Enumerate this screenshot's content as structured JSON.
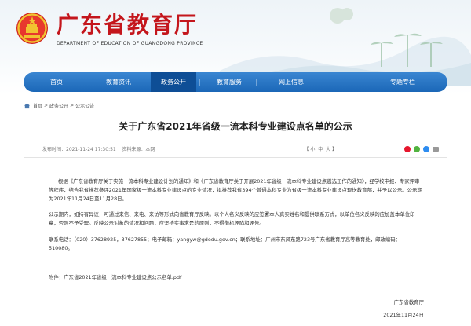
{
  "header": {
    "title": "广东省教育厅",
    "subtitle": "DEPARTMENT OF EDUCATION OF GUANGDONG PROVINCE"
  },
  "nav": {
    "items": [
      {
        "label": "首页"
      },
      {
        "label": "教育资讯"
      },
      {
        "label": "政务公开",
        "active": true
      },
      {
        "label": "教育服务"
      },
      {
        "label": "网上信息"
      },
      {
        "label": "专题专栏"
      }
    ]
  },
  "breadcrumb": {
    "home": "首页",
    "sep": ">",
    "level1": "政务公开",
    "level2": "公示公告"
  },
  "article": {
    "title": "关于广东省2021年省级一流本科专业建设点名单的公示",
    "date": "发布时间：2021-11-24 17:30:51",
    "source": "资料来源：本网",
    "font_label": "【",
    "font_small": "小",
    "font_mid": "中",
    "font_big": "大",
    "font_end": "】",
    "p1": "根据《广东省教育厅关于实施一流本科专业建设计划的通知》和《广东省教育厅关于开展2021年省级一流本科专业建设点遴选工作的通知》，经学校申报、专家评审等程序，结合我省推荐参评2021年国家级一流本科专业建设点的专业情况，拟推荐我省394个普通本科专业为省级一流本科专业建设点现送教育部，并予以公示。公示期为2021年11月24日至11月28日。",
    "p2": "公示期内，如持有异议，可通过来信、来电、来访等形式向省教育厅反映。以个人名义反映的应签署本人真实姓名和提供联系方式，以单位名义反映的应加盖本单位印章，否则不予受理。反映公示对象的情况和问题，应坚持实事求是的原则，不得借机诬陷和诬告。",
    "p3": "联系电话：（020）37628925，37627855；电子邮箱：yangyw@gdedu.gov.cn；联系地址：广州市东风东路723号广东省教育厅高等教育处，邮政编码：510080。",
    "attachment": "附件：广东省2021年省级一流本科专业建设点公示名单.pdf",
    "sign_org": "广东省教育厅",
    "sign_date": "2021年11月24日"
  },
  "colors": {
    "brand_red": "#c4161c",
    "nav_blue": "#1b67b7",
    "nav_active": "#0e4e96"
  }
}
